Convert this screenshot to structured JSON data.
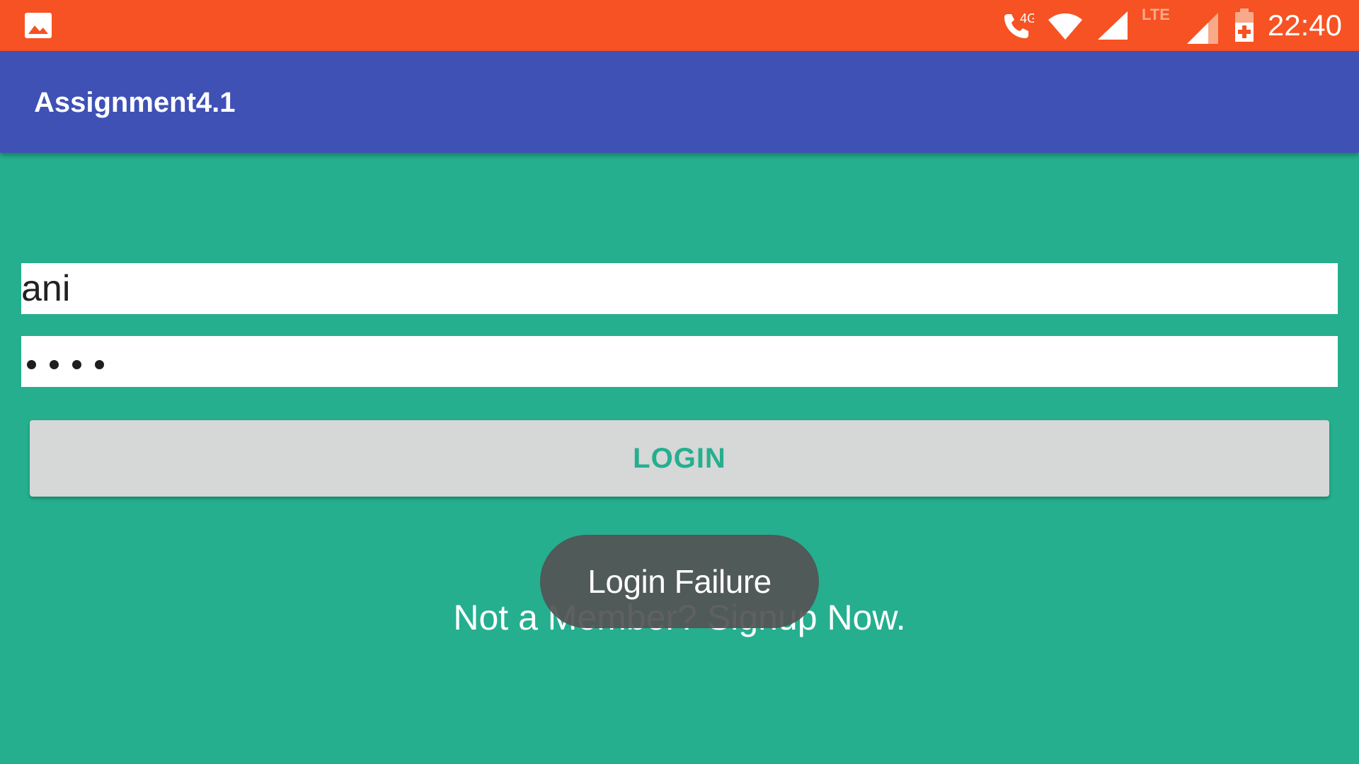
{
  "status_bar": {
    "time": "22:40",
    "call_badge": "4G",
    "network_type": "LTE",
    "icons": [
      "image-icon",
      "call-icon",
      "wifi-icon",
      "signal-icon",
      "signal-icon",
      "battery-charging-icon"
    ],
    "background_color": "#f65223"
  },
  "app_bar": {
    "title": "Assignment4.1",
    "background_color": "#3f51b5"
  },
  "form": {
    "username_value": "ani",
    "password_masked": "••••",
    "login_label": "LOGIN",
    "signup_text": "Not a Member? Signup Now.",
    "background_color": "#25af8f",
    "button_color": "#d6d7d7"
  },
  "toast": {
    "message": "Login Failure"
  }
}
